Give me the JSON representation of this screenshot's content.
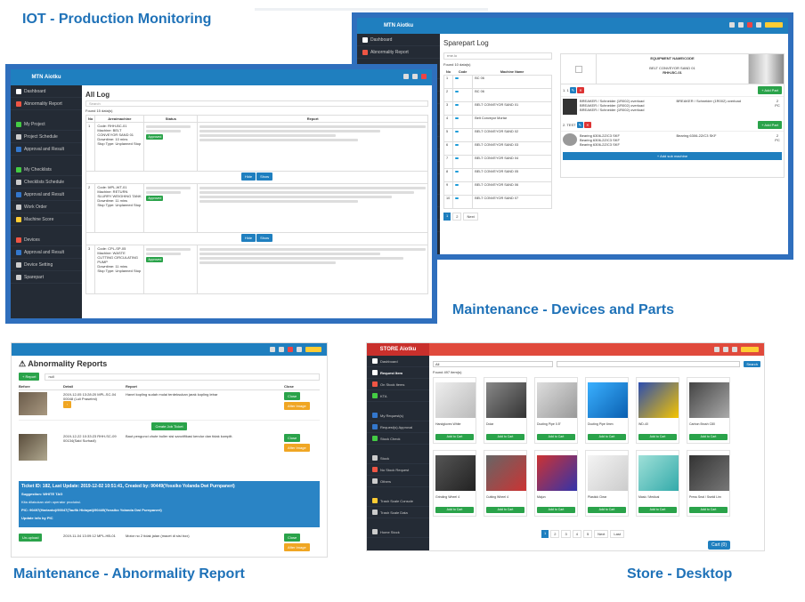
{
  "captions": {
    "iot": "IOT - Production Monitoring",
    "devices": "Maintenance - Devices and Parts",
    "abnormality": "Maintenance - Abnormality Report",
    "store": "Store - Desktop"
  },
  "allog": {
    "brand": "MTN Aiotku",
    "title": "All Log",
    "search_placeholder": "Search",
    "found": "Found 15 data(s)",
    "columns": [
      "No",
      "Area/machine",
      "Status",
      "Report"
    ],
    "sidebar": [
      "Dashboard",
      "Abnormality Report",
      "My Project",
      "Project Schedule",
      "Approval and Result",
      "My Checklists",
      "Checklists Schedule",
      "Approval and Result",
      "Work Order",
      "Machine Score",
      "Devices",
      "Approval and Result",
      "Device Setting",
      "Sparepart"
    ],
    "rows": [
      {
        "no": "1",
        "code": "Code: RHH-BC-01",
        "machine": "Machine: BELT CONVEYOR SAND 01",
        "downtime": "Downtime: 10 mins",
        "stop": "Stop Type: Unplanned Stop",
        "status": "Approved",
        "buttons": [
          "Hide",
          "Show"
        ]
      },
      {
        "no": "2",
        "code": "Code: MPL-WT-01",
        "machine": "Machine: RETURN SLURRY WEIGHING TANK",
        "downtime": "Downtime: 11 mins",
        "stop": "Stop Type: Unplanned Stop",
        "status": "Approved",
        "buttons": [
          "Hide",
          "Show"
        ]
      },
      {
        "no": "3",
        "code": "Code: CPL-SP-05",
        "machine": "Machine: WASTE CUTTING CIRCULATING PUMP",
        "downtime": "Downtime: 11 mins",
        "stop": "Stop Type: Unplanned Stop",
        "status": "Approved",
        "buttons": []
      }
    ]
  },
  "sparepart": {
    "brand": "MTN Aiotku",
    "title": "Sparepart Log",
    "search_placeholder": "rme.lo",
    "found": "Found 10 data(s)",
    "columns": [
      "No",
      "Code",
      "Machine Name"
    ],
    "rows": [
      {
        "no": "1",
        "name": "BC 06"
      },
      {
        "no": "2",
        "name": "BC 06"
      },
      {
        "no": "3",
        "name": "BELT CONVEYOR SAND 01"
      },
      {
        "no": "4",
        "name": "Belt Conveyor Mortar"
      },
      {
        "no": "5",
        "name": "BELT CONVEYOR SAND 02"
      },
      {
        "no": "6",
        "name": "BELT CONVEYOR SAND 03"
      },
      {
        "no": "7",
        "name": "BELT CONVEYOR SAND 04"
      },
      {
        "no": "8",
        "name": "BELT CONVEYOR SAND 05"
      },
      {
        "no": "9",
        "name": "BELT CONVEYOR SAND 06"
      },
      {
        "no": "10",
        "name": "BELT CONVEYOR SAND 07"
      }
    ],
    "pages": [
      "1",
      "2",
      "Next"
    ],
    "detail": {
      "header": "EQUIPMENT NAME/CODE",
      "equipment": "BELT CONVEYOR SAND 01",
      "code": "RHH-BC-01",
      "group1": "1. 1",
      "group2": "2. TEST",
      "add_part": "+ Add Part",
      "part1": "BREAKER / Schneider (1R002) overload",
      "part2": "Bearing 6306-2Z/C3 SKF",
      "unit": "PC",
      "qty": "2",
      "add_machine": "+ Add sub machine"
    }
  },
  "abnormality": {
    "title": "Abnormality Reports",
    "report_btn": "+ Report",
    "search_value": "null",
    "columns": [
      "Before",
      "Detail",
      "Report",
      "Close"
    ],
    "row1": {
      "detail": "2019-12-05 13:28:20 MPL-SC-04 00048 (Luli Prasetmi)",
      "report": "Hanel kopling sudah mulai terdeksukan jarak kopling lebar",
      "close": "Close",
      "after": "After Image"
    },
    "create_btn": "Create Job Ticket",
    "row2": {
      "detail": "2019-12-22 10:33:23 RHH-SC-09 00134(Said Surhadi)",
      "report": "Baut pengunci chute buller sisi sanctifikasi kendur dan tidak komplit.",
      "close": "Close",
      "after": "After Image"
    },
    "ticket": {
      "title": "Ticket ID: 182, Last Update: 2019-12-02 10:51:41, Created by: 90449(Yossiko Yolanda Dwi Purnpaneri)",
      "suggestion": "Suggestion: WHITE TAG",
      "note": "Kita dilakukan oleh operator produksi.",
      "pic": "PIC: 90497(Harianto)/90047(Taufik Hidayat)/90449(Yossiko Yolanda Dwi Purnpaneri)",
      "update": "Update info by PIC"
    },
    "row3": {
      "detail": "2019-11-04 13:09:12 MPL-HB-01",
      "report": "Motor no 2 tidak jalan (macet di sisi box)",
      "close": "Close",
      "after": "After Image"
    },
    "unupload": "Un-upload"
  },
  "store": {
    "brand": "STORE Aiotku",
    "found": "Found 497 item(s)",
    "select": "All",
    "search_btn": "Search",
    "cart": "Cart (0)",
    "add_label": "Add to Cart",
    "sidebar": [
      "Dashboard",
      "Request Item",
      "On Stock Items",
      "KTA",
      "My Request(s)",
      "Request(s) Approval",
      "Stock Check",
      "Stock",
      "No Stock Request",
      "Others",
      "Trash Scale Console",
      "Trash Scale Data",
      "Home Stock"
    ],
    "products": [
      "Handgloves White",
      "Dolar",
      "Ducting Pipe 0.5\"",
      "Ducting Pipe 6mm",
      "WD-40",
      "Carbon Brush C80",
      "Grinding Wheel 4",
      "Cutting Wheel 4",
      "Majun",
      "Plastick Clear",
      "Mask / Medical",
      "Press Seal / Ssekil Lim"
    ],
    "pages": [
      "1",
      "2",
      "3",
      "4",
      "5",
      "Next",
      "Last"
    ]
  }
}
